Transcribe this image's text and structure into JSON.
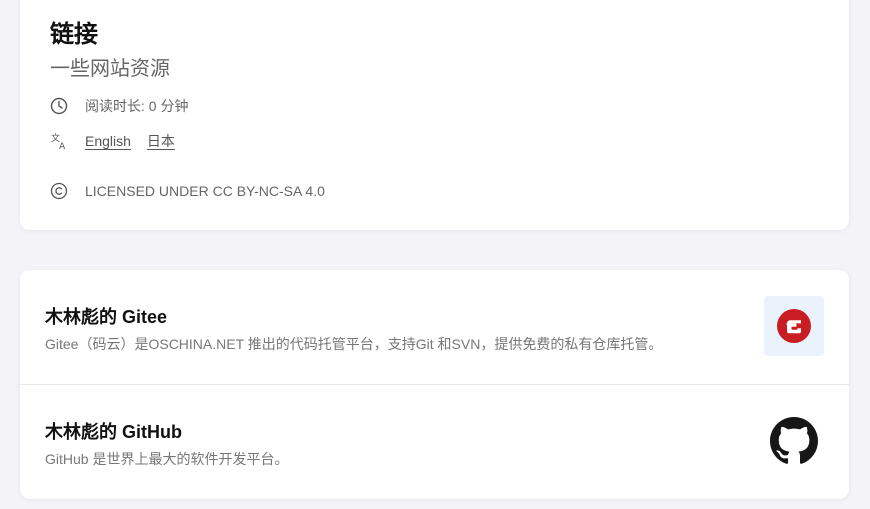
{
  "header": {
    "title": "链接",
    "subtitle": "一些网站资源",
    "reading_time": "阅读时长: 0 分钟",
    "languages": [
      "English",
      "日本"
    ],
    "license": "LICENSED UNDER CC BY-NC-SA 4.0"
  },
  "icons": {
    "clock": "clock-icon",
    "translate": "translate-icon",
    "copyright": "copyright-icon",
    "gitee": "gitee-logo-icon",
    "github": "github-logo-icon"
  },
  "links": [
    {
      "title": "木林彪的 Gitee",
      "description": "Gitee（码云）是OSCHINA.NET 推出的代码托管平台，支持Git 和SVN，提供免费的私有仓库托管。"
    },
    {
      "title": "木林彪的 GitHub",
      "description": "GitHub 是世界上最大的软件开发平台。"
    }
  ],
  "colors": {
    "gitee_red": "#c71d23",
    "github_black": "#181717",
    "page_bg": "#f4f4f8"
  }
}
